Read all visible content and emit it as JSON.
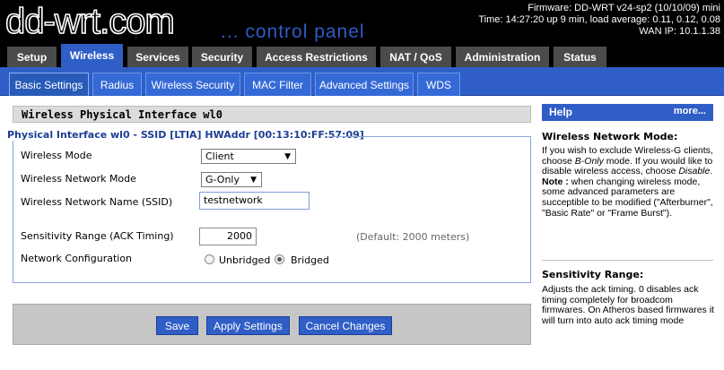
{
  "header": {
    "logo": "dd-wrt.com",
    "subtitle": "... control panel",
    "firmware": "Firmware: DD-WRT v24-sp2 (10/10/09) mini",
    "time": "Time: 14:27:20 up 9 min, load average: 0.11, 0.12, 0.08",
    "wan_ip": "WAN IP: 10.1.1.38"
  },
  "main_tabs": [
    "Setup",
    "Wireless",
    "Services",
    "Security",
    "Access Restrictions",
    "NAT / QoS",
    "Administration",
    "Status"
  ],
  "sub_tabs": [
    "Basic Settings",
    "Radius",
    "Wireless Security",
    "MAC Filter",
    "Advanced Settings",
    "WDS"
  ],
  "section": {
    "title": "Wireless Physical Interface wl0",
    "legend": "Physical Interface wl0 - SSID [LTIA] HWAddr [00:13:10:FF:57:09]"
  },
  "form": {
    "wireless_mode_label": "Wireless Mode",
    "wireless_mode_value": "Client",
    "network_mode_label": "Wireless Network Mode",
    "network_mode_value": "G-Only",
    "ssid_label": "Wireless Network Name (SSID)",
    "ssid_value": "testnetwork",
    "sensitivity_label": "Sensitivity Range (ACK Timing)",
    "sensitivity_value": "2000",
    "sensitivity_default": "(Default: 2000 meters)",
    "netconf_label": "Network Configuration",
    "netconf_unbridged": "Unbridged",
    "netconf_bridged": "Bridged",
    "netconf_selected": "Bridged"
  },
  "buttons": {
    "save": "Save",
    "apply": "Apply Settings",
    "cancel": "Cancel Changes"
  },
  "help": {
    "title": "Help",
    "more": "more...",
    "wnm_heading": "Wireless Network Mode:",
    "wnm_p1": "If you wish to exclude Wireless-G clients, choose ",
    "wnm_p1_em": "B-Only",
    "wnm_p1b": " mode. If you would like to disable wireless access, choose ",
    "wnm_p1_em2": "Disable",
    "wnm_p1c": ".",
    "wnm_note_label": "Note :",
    "wnm_note": " when changing wireless mode, some advanced parameters are succeptible to be modified (\"Afterburner\", \"Basic Rate\" or \"Frame Burst\").",
    "sr_heading": "Sensitivity Range:",
    "sr_text": "Adjusts the ack timing. 0 disables ack timing completely for broadcom firmwares. On Atheros based firmwares it will turn into auto ack timing mode"
  },
  "colors": {
    "accent": "#2f5ec7",
    "header_bg": "#000000",
    "tab_bg": "#4b4b4b"
  }
}
